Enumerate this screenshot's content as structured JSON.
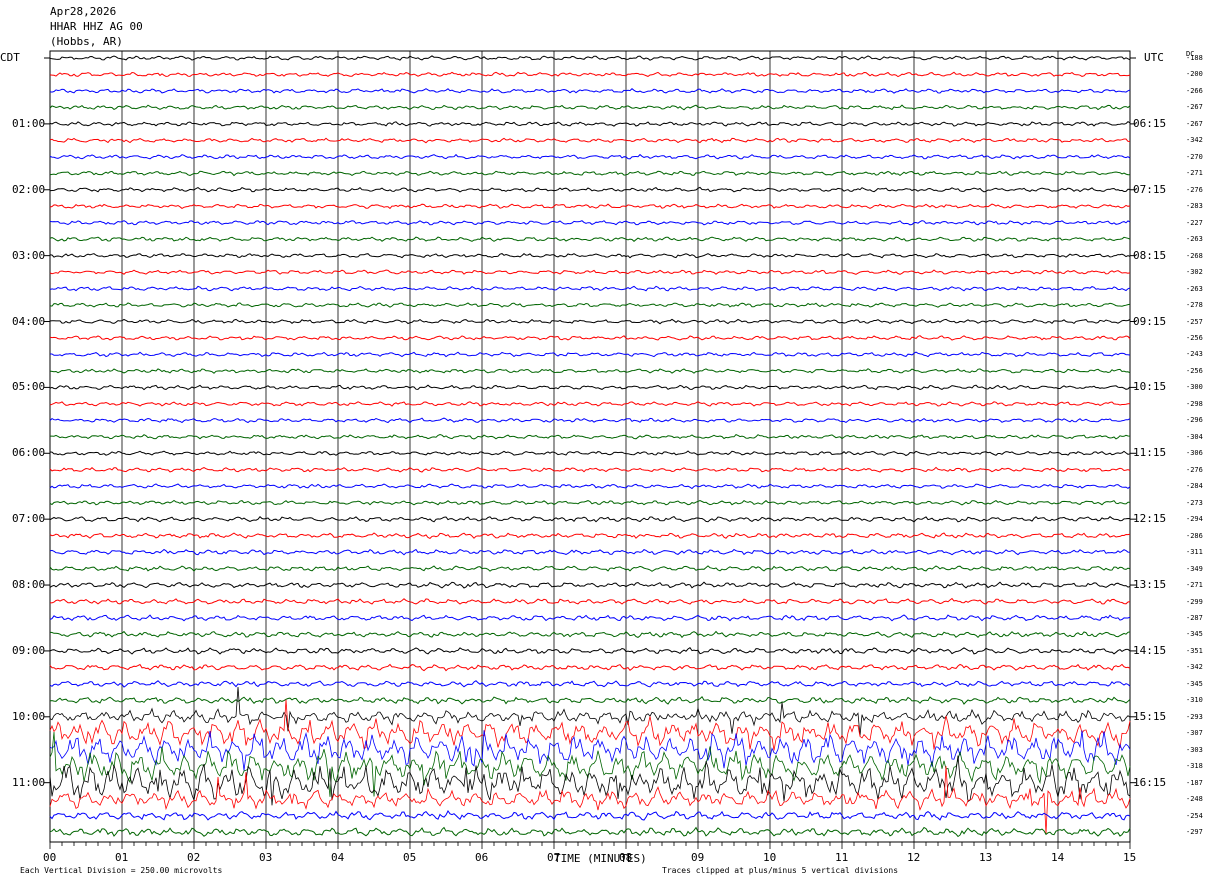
{
  "header": {
    "date": "Apr28,2026",
    "station": "HHAR HHZ AG 00",
    "location": "(Hobbs, AR)"
  },
  "chart_data": {
    "type": "line",
    "subtype": "helicorder",
    "left_axis_title": "CDT",
    "right_axis_title": "UTC",
    "dc_title": "DC",
    "xlabel": "TIME (MINUTES)",
    "x_ticks": [
      "00",
      "01",
      "02",
      "03",
      "04",
      "05",
      "06",
      "07",
      "08",
      "09",
      "10",
      "11",
      "12",
      "13",
      "14",
      "15"
    ],
    "xlim": [
      0,
      15
    ],
    "trace_count": 48,
    "trace_colors": [
      "#000000",
      "#ff0000",
      "#0000ff",
      "#006400"
    ],
    "left_time_labels": [
      "01:00",
      "02:00",
      "03:00",
      "04:00",
      "05:00",
      "06:00",
      "07:00",
      "08:00",
      "09:00",
      "10:00",
      "11:00"
    ],
    "right_time_labels": [
      "06:15",
      "07:15",
      "08:15",
      "09:15",
      "10:15",
      "11:15",
      "12:15",
      "13:15",
      "14:15",
      "15:15",
      "16:15"
    ],
    "dc_offsets": [
      "-188",
      "-200",
      "-266",
      "-267",
      "-267",
      "-342",
      "-270",
      "-271",
      "-276",
      "-283",
      "-227",
      "-263",
      "-268",
      "-302",
      "-263",
      "-278",
      "-257",
      "-256",
      "-243",
      "-256",
      "-300",
      "-298",
      "-296",
      "-304",
      "-306",
      "-276",
      "-284",
      "-273",
      "-294",
      "-286",
      "-311",
      "-349",
      "-271",
      "-299",
      "-287",
      "-345",
      "-351",
      "-342",
      "-345",
      "-310",
      "-293",
      "-307",
      "-303",
      "-318",
      "-187",
      "-248",
      "-254",
      "-297"
    ],
    "amplitude_level": [
      1,
      1,
      1,
      1,
      1,
      1,
      1,
      1,
      1,
      1,
      1,
      1,
      1,
      1,
      1,
      1,
      1,
      1,
      1,
      1,
      1,
      1,
      1,
      1,
      1,
      1,
      1,
      1,
      1.2,
      1.2,
      1.2,
      1.2,
      1.3,
      1.3,
      1.3,
      1.3,
      1.4,
      1.4,
      1.4,
      1.6,
      3,
      6,
      7,
      7,
      8,
      4,
      2,
      2
    ],
    "footer_left": "Each Vertical Division =  250.00 microvolts",
    "footer_right": "Traces clipped at plus/minus 5 vertical divisions"
  }
}
